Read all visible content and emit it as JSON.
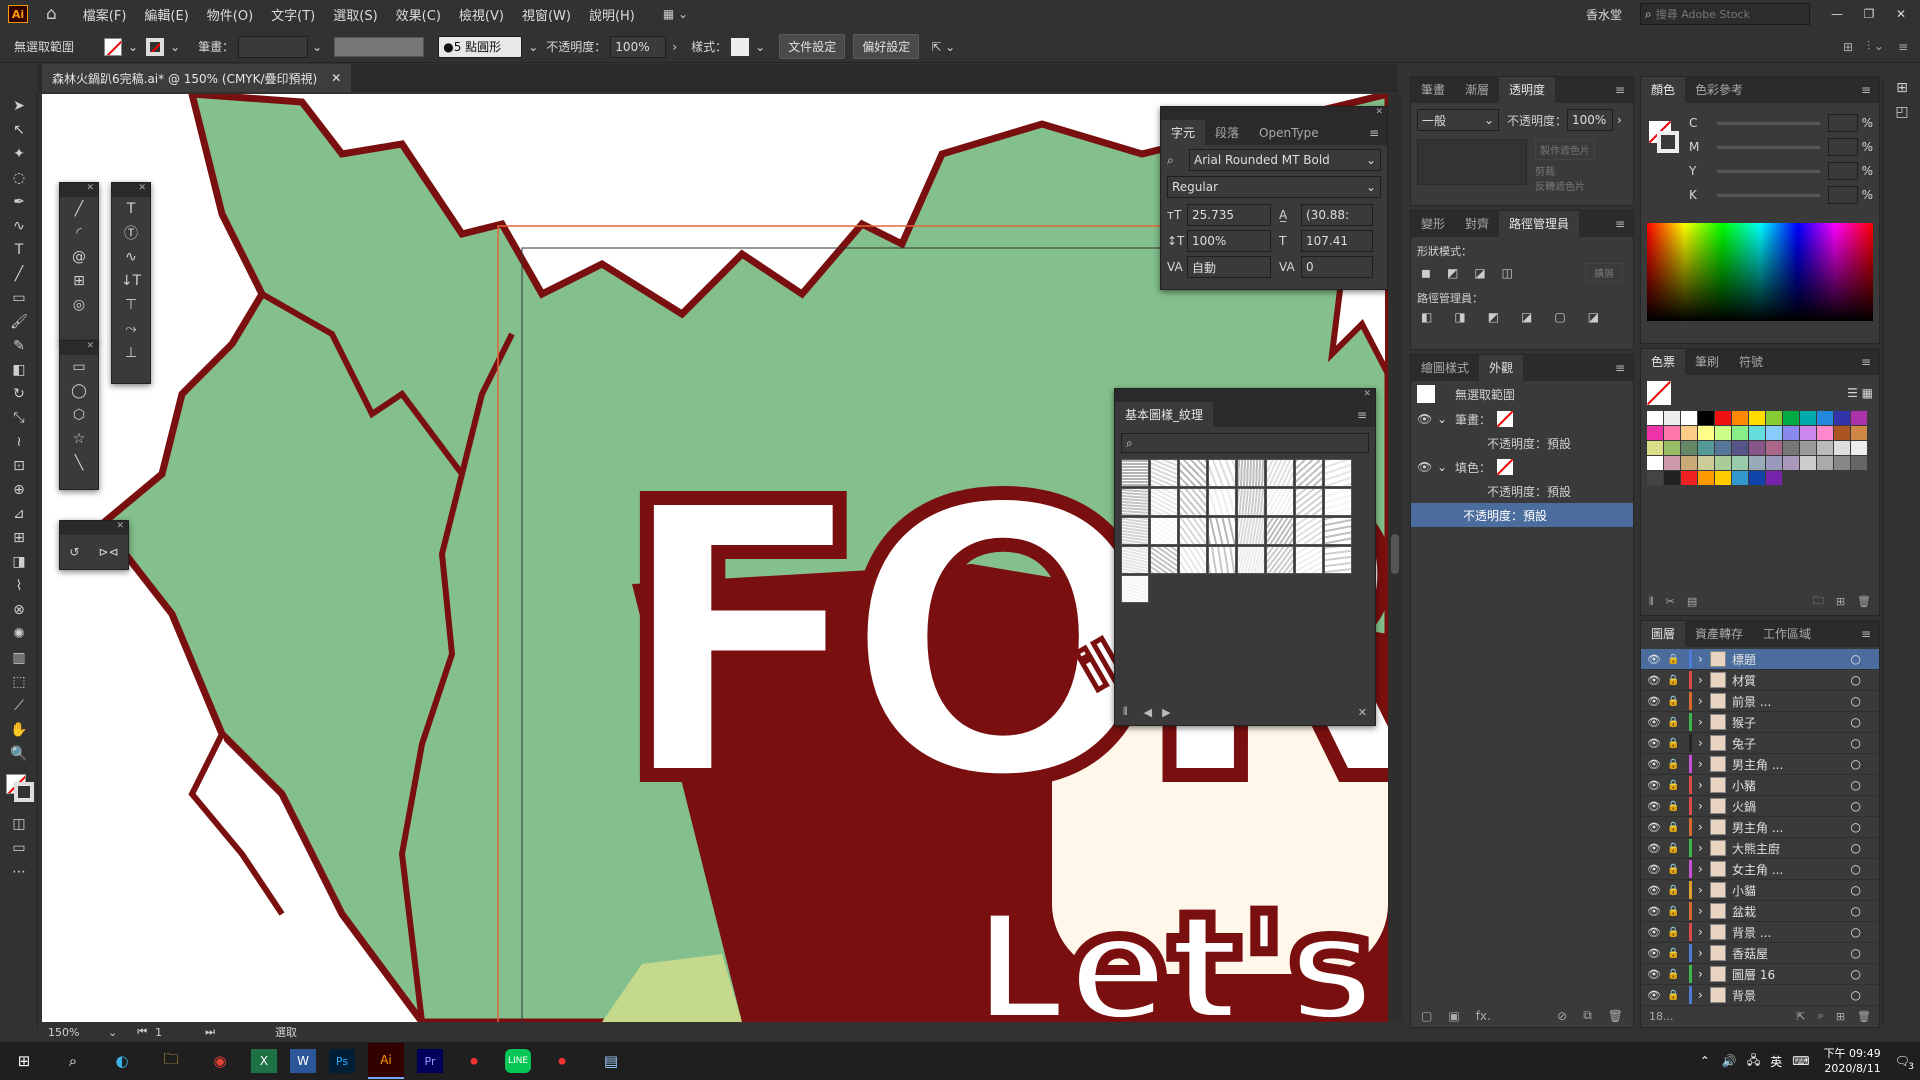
{
  "app": {
    "logo": "Ai",
    "home_icon": "home-icon"
  },
  "menu": [
    "檔案(F)",
    "編輯(E)",
    "物件(O)",
    "文字(T)",
    "選取(S)",
    "效果(C)",
    "檢視(V)",
    "視窗(W)",
    "說明(H)"
  ],
  "workspace": "香水堂",
  "search_placeholder": "搜尋 Adobe Stock",
  "options": {
    "selection": "無選取範圍",
    "stroke_label": "筆畫：",
    "brush": "5 點圓形",
    "opacity_label": "不透明度：",
    "opacity": "100%",
    "style_label": "樣式：",
    "doc_setup": "文件設定",
    "prefs": "偏好設定"
  },
  "document_tab": {
    "title": "森林火鍋趴6完稿.ai* @ 150% (CMYK/疊印預視)"
  },
  "status": {
    "zoom": "150%",
    "artboard": "1",
    "tool": "選取"
  },
  "canvas_text": {
    "main": "FORES",
    "sub": "Let's Ha",
    "small": "il"
  },
  "character_panel": {
    "tabs": [
      "字元",
      "段落",
      "OpenType"
    ],
    "font": "Arial Rounded MT Bold",
    "style": "Regular",
    "size": "25.735",
    "leading": "(30.88:",
    "hscale": "100%",
    "vscale": "107.41",
    "kerning": "自動",
    "tracking": "0"
  },
  "patterns_panel": {
    "title": "基本圖樣_紋理"
  },
  "transparency_panel": {
    "tabs": [
      "筆畫",
      "漸層",
      "透明度"
    ],
    "mode": "一般",
    "opacity_label": "不透明度：",
    "opacity": "100%",
    "mask_btn": "製作遮色片",
    "clip": "剪裁",
    "invert": "反轉遮色片"
  },
  "pathfinder_panel": {
    "tabs": [
      "變形",
      "對齊",
      "路徑管理員"
    ],
    "shape_modes": "形狀模式：",
    "expand": "擴展",
    "pathfinders": "路徑管理員："
  },
  "appearance_panel": {
    "tabs": [
      "繪圖樣式",
      "外觀"
    ],
    "title": "無選取範圍",
    "stroke": "筆畫：",
    "stroke_opacity": "不透明度：預設",
    "fill": "填色：",
    "fill_opacity": "不透明度：預設",
    "opacity": "不透明度：預設"
  },
  "color_panel": {
    "tabs": [
      "顏色",
      "色彩參考"
    ],
    "channels": [
      "C",
      "M",
      "Y",
      "K"
    ],
    "pct": "%"
  },
  "swatches_panel": {
    "tabs": [
      "色票",
      "筆刷",
      "符號"
    ]
  },
  "layers_panel": {
    "tabs": [
      "圖層",
      "資產轉存",
      "工作區域"
    ],
    "count": "18...",
    "layers": [
      {
        "name": "標題",
        "color": "#4f7bd8"
      },
      {
        "name": "材質",
        "color": "#d94b4b"
      },
      {
        "name": "前景 ...",
        "color": "#d66a2c"
      },
      {
        "name": "猴子",
        "color": "#3cb84a"
      },
      {
        "name": "兔子",
        "color": "#222222"
      },
      {
        "name": "男主角 ...",
        "color": "#c84fd8"
      },
      {
        "name": "小豬",
        "color": "#d94b4b"
      },
      {
        "name": "火鍋",
        "color": "#d94b4b"
      },
      {
        "name": "男主角 ...",
        "color": "#d66a2c"
      },
      {
        "name": "大熊主廚",
        "color": "#3cb84a"
      },
      {
        "name": "女主角 ...",
        "color": "#c84fd8"
      },
      {
        "name": "小貓",
        "color": "#e0a030"
      },
      {
        "name": "盆栽",
        "color": "#d66a2c"
      },
      {
        "name": "背景 ...",
        "color": "#d94b4b"
      },
      {
        "name": "香菇屋",
        "color": "#4f7bd8"
      },
      {
        "name": "圖層 16",
        "color": "#3cb84a"
      },
      {
        "name": "背景",
        "color": "#4f7bd8"
      }
    ]
  },
  "taskbar": {
    "time": "下午 09:49",
    "date": "2020/8/11",
    "lang": "英",
    "notif": "3"
  }
}
